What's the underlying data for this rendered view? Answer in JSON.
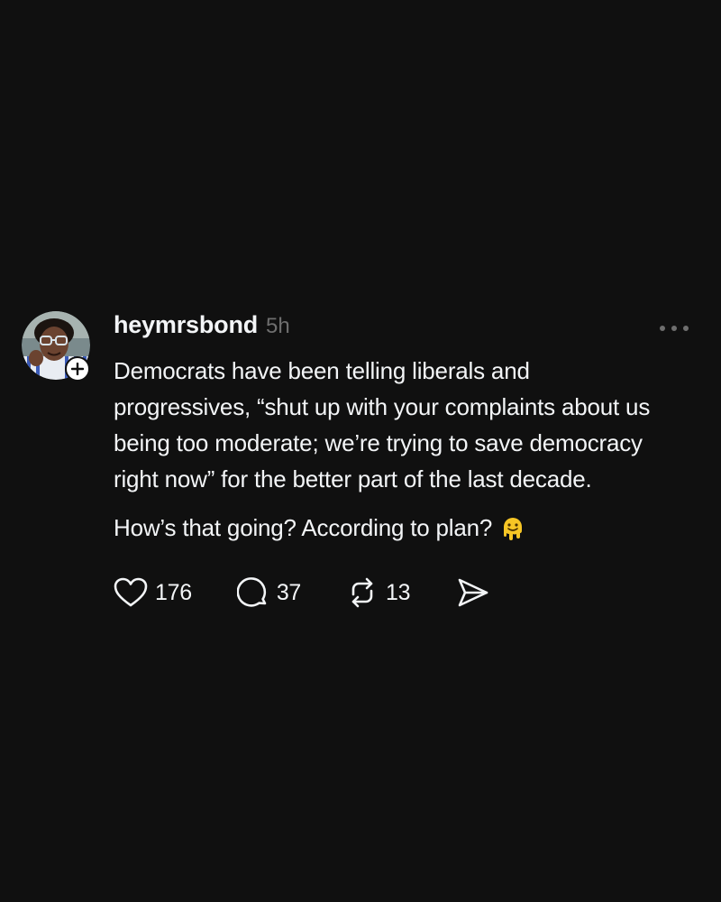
{
  "post": {
    "username": "heymrsbond",
    "timestamp": "5h",
    "body_paragraph_1": "Democrats have been telling liberals and\nprogressives, “shut up with your complaints about us\nbeing too moderate; we’re trying to save democracy\nright now” for the better part of the last decade.",
    "body_paragraph_2": "How’s that going? According to plan?",
    "emoji": "melting-face",
    "avatar_icon": "profile-photo",
    "follow_icon": "plus-icon",
    "more_icon": "more-horizontal-icon"
  },
  "actions": {
    "likes": "176",
    "replies": "37",
    "reposts": "13",
    "like_icon": "heart-icon",
    "reply_icon": "speech-bubble-icon",
    "repost_icon": "repost-icon",
    "share_icon": "send-icon"
  },
  "colors": {
    "background": "#101010",
    "text": "#f3f5f7",
    "secondary_text": "#6e6e6e"
  }
}
